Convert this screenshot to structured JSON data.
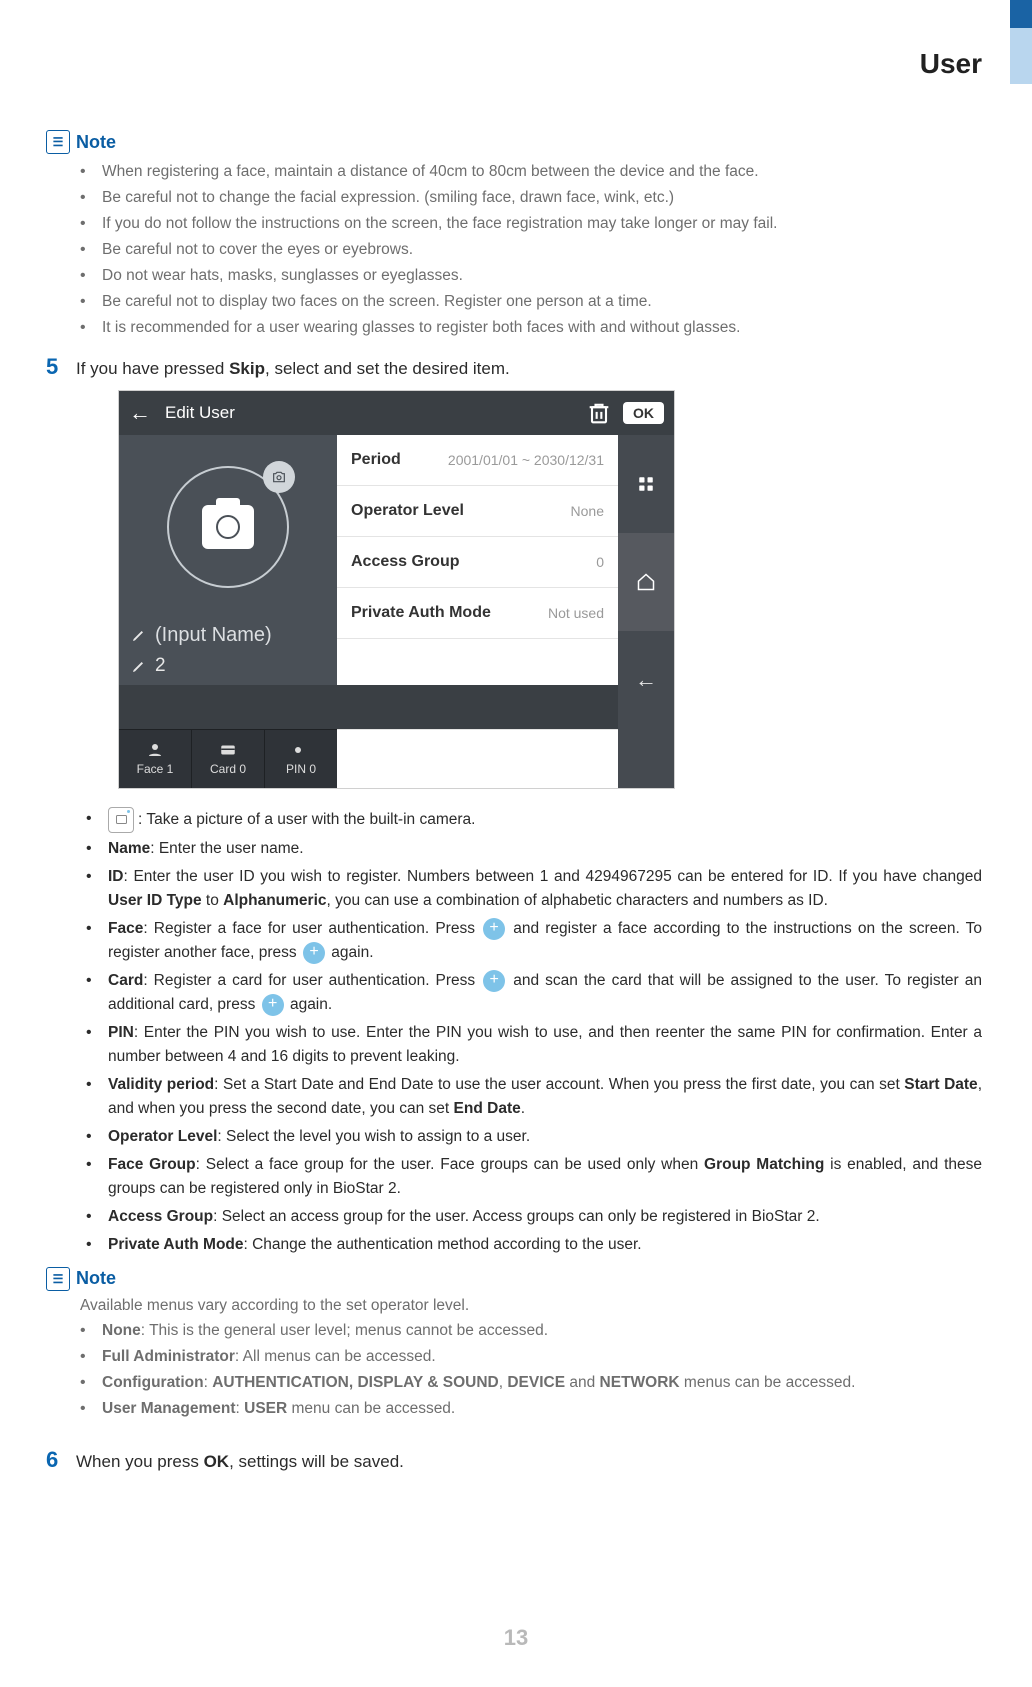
{
  "header": {
    "section_title": "User"
  },
  "note1": {
    "heading": "Note",
    "items": [
      "When registering a face, maintain a distance of 40cm to 80cm between the device and the face.",
      "Be careful not to change the facial expression. (smiling face, drawn face, wink, etc.)",
      "If you do not follow the instructions on the screen, the face registration may take longer or may fail.",
      "Be careful not to cover the eyes or eyebrows.",
      "Do not wear hats, masks, sunglasses or eyeglasses.",
      "Be careful not to display two faces on the screen. Register one person at a time.",
      "It is recommended for a user wearing glasses to register both faces with and without glasses."
    ]
  },
  "step5": {
    "num": "5",
    "text_before": "If you have pressed ",
    "text_bold": "Skip",
    "text_after": ", select and set the desired item."
  },
  "device": {
    "title": "Edit User",
    "ok": "OK",
    "input_name": "(Input Name)",
    "user_id": "2",
    "creds": {
      "face": "Face 1",
      "card": "Card 0",
      "pin": "PIN 0"
    },
    "fields": {
      "period_label": "Period",
      "period_value": "2001/01/01 ~  2030/12/31",
      "op_label": "Operator Level",
      "op_value": "None",
      "ag_label": "Access Group",
      "ag_value": "0",
      "pam_label": "Private Auth Mode",
      "pam_value": "Not used"
    }
  },
  "descs": {
    "cam": ": Take a picture of a user with the built-in camera.",
    "name_b": "Name",
    "name_t": ": Enter the user name.",
    "id_b": "ID",
    "id_t1": ": Enter the user ID you wish to register. Numbers between 1 and 4294967295 can be entered for ID. If you have changed ",
    "id_bold2": "User ID Type",
    "id_t2": " to ",
    "id_bold3": "Alphanumeric",
    "id_t3": ", you can use a combination of alphabetic characters and numbers as ID.",
    "face_b": "Face",
    "face_t1": ": Register a face for user authentication. Press ",
    "face_t2": " and register a face according to the instructions on the screen. To register another face, press ",
    "face_t3": " again.",
    "card_b": "Card",
    "card_t1": ": Register a card for user authentication. Press ",
    "card_t2": " and scan the card that will be assigned to the user. To register an additional card, press ",
    "card_t3": " again.",
    "pin_b": "PIN",
    "pin_t": ": Enter the PIN you wish to use. Enter the PIN you wish to use, and then reenter the same PIN for confirmation. Enter a number between 4 and 16 digits to prevent leaking.",
    "vp_b": "Validity period",
    "vp_t1": ": Set a Start Date and End Date to use the user account. When you press the first date, you can set ",
    "vp_bold1": "Start Date",
    "vp_t2": ", and when you press the second date, you can set ",
    "vp_bold2": "End Date",
    "vp_t3": ".",
    "ol_b": "Operator Level",
    "ol_t": ": Select the level you wish to assign to a user.",
    "fg_b": "Face Group",
    "fg_t1": ": Select a face group for the user. Face groups can be used only when ",
    "fg_bold": "Group Matching",
    "fg_t2": " is enabled, and these groups can be registered only in BioStar 2.",
    "ag_b": "Access Group",
    "ag_t": ": Select an access group for the user. Access groups can only be registered in BioStar 2.",
    "pam_b": "Private Auth Mode",
    "pam_t": ": Change the authentication method according to the user."
  },
  "note2": {
    "heading": "Note",
    "lead": "Available menus vary according to the set operator level.",
    "items": {
      "none_b": "None",
      "none_t": ": This is the general user level; menus cannot be accessed.",
      "fa_b": "Full Administrator",
      "fa_t": ": All menus can be accessed.",
      "cfg_b": "Configuration",
      "cfg_t1": ": ",
      "cfg_bold1": "AUTHENTICATION, DISPLAY & SOUND",
      "cfg_t2": ", ",
      "cfg_bold2": "DEVICE",
      "cfg_t3": " and ",
      "cfg_bold3": "NETWORK",
      "cfg_t4": " menus can be accessed.",
      "um_b": "User Management",
      "um_t1": ": ",
      "um_bold1": "USER",
      "um_t2": " menu can be accessed."
    }
  },
  "step6": {
    "num": "6",
    "text_before": "When you press ",
    "text_bold": "OK",
    "text_after": ", settings will be saved."
  },
  "footer": {
    "page": "13"
  }
}
